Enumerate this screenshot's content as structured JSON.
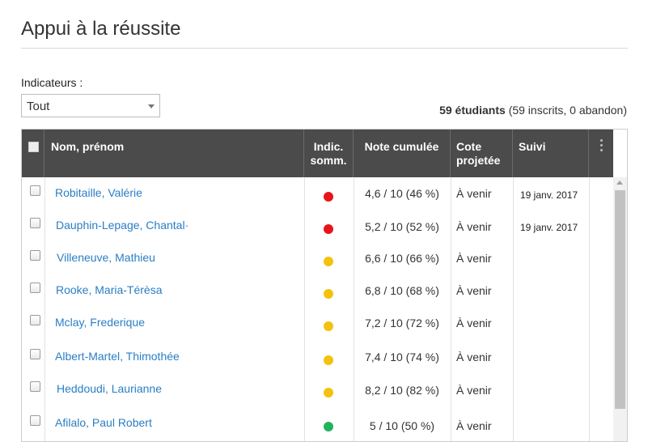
{
  "page": {
    "title": "Appui à la réussite"
  },
  "filter": {
    "label": "Indicateurs :",
    "selected": "Tout"
  },
  "summary": {
    "count": "59 étudiants",
    "detail": "(59 inscrits, 0 abandon)"
  },
  "table": {
    "headers": {
      "name": "Nom, prénom",
      "indic_line1": "Indic.",
      "indic_line2": "somm.",
      "note": "Note cumulée",
      "cote_line1": "Cote",
      "cote_line2": "projetée",
      "suivi": "Suivi"
    },
    "rows": [
      {
        "name": "Robitaille, Valérie",
        "indicator": "red",
        "note": "4,6 / 10 (46 %)",
        "cote": "À venir",
        "suivi": "19 janv. 2017"
      },
      {
        "name": "Dauphin-Lepage, Chantal·",
        "indicator": "red",
        "note": "5,2 / 10 (52 %)",
        "cote": "À venir",
        "suivi": "19 janv. 2017"
      },
      {
        "name": "Villeneuve, Mathieu",
        "indicator": "yellow",
        "note": "6,6 / 10 (66 %)",
        "cote": "À venir",
        "suivi": ""
      },
      {
        "name": "Rooke, Maria-Térèsa",
        "indicator": "yellow",
        "note": "6,8 / 10 (68 %)",
        "cote": "À venir",
        "suivi": ""
      },
      {
        "name": "Mclay, Frederique",
        "indicator": "yellow",
        "note": "7,2 / 10 (72 %)",
        "cote": "À venir",
        "suivi": ""
      },
      {
        "name": "Albert-Martel, Thimothée",
        "indicator": "yellow",
        "note": "7,4 / 10 (74 %)",
        "cote": "À venir",
        "suivi": ""
      },
      {
        "name": "Heddoudi, Laurianne",
        "indicator": "yellow",
        "note": "8,2 / 10 (82 %)",
        "cote": "À venir",
        "suivi": ""
      },
      {
        "name": "Afilalo, Paul Robert",
        "indicator": "green",
        "note": "5 / 10 (50 %)",
        "cote": "À venir",
        "suivi": ""
      }
    ]
  },
  "colors": {
    "red": "#e8141c",
    "yellow": "#f4c20d",
    "green": "#22b35f",
    "header_bg": "#4b4b4b",
    "link": "#2a7ec4"
  }
}
